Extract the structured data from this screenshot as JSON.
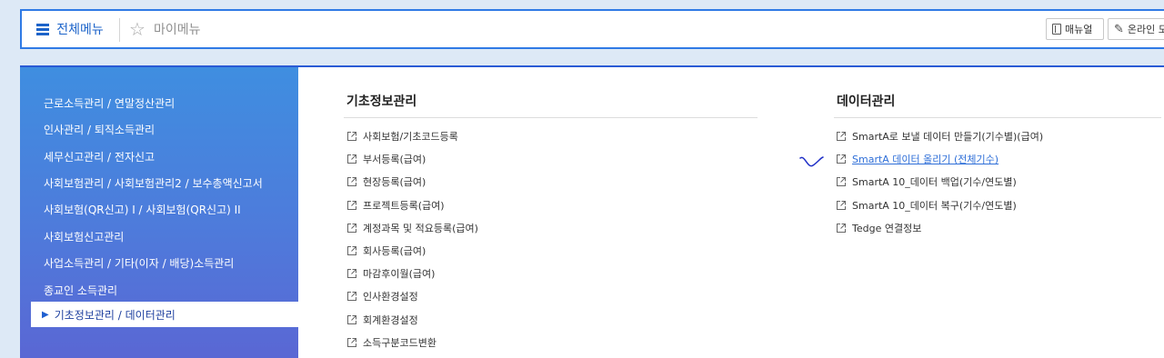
{
  "topbar": {
    "all_menu_label": "전체메뉴",
    "my_menu_label": "마이메뉴",
    "manual_label": "매뉴얼",
    "online_label": "온라인 도움말"
  },
  "sidebar": {
    "items": [
      "근로소득관리 / 연말정산관리",
      "인사관리 / 퇴직소득관리",
      "세무신고관리 / 전자신고",
      "사회보험관리 / 사회보험관리2 / 보수총액신고서",
      "사회보험(QR신고) I  / 사회보험(QR신고) II",
      "사회보험신고관리",
      "사업소득관리 / 기타(이자 / 배당)소득관리",
      "종교인 소득관리",
      "기초정보관리 / 데이터관리"
    ],
    "active_index": 8
  },
  "basic_section": {
    "title": "기초정보관리",
    "links": [
      "사회보험/기초코드등록",
      "부서등록(급여)",
      "현장등록(급여)",
      "프로젝트등록(급여)",
      "계정과목 및 적요등록(급여)",
      "회사등록(급여)",
      "마감후이월(급여)",
      "인사환경설정",
      "회계환경설정",
      "소득구분코드변환"
    ]
  },
  "data_section": {
    "title": "데이터관리",
    "links": [
      "SmartA로 보낼 데이터 만들기(기수별)(급여)",
      "SmartA 데이터 올리기 (전체기수)",
      "SmartA 10_데이터 백업(기수/연도별)",
      "SmartA 10_데이터 복구(기수/연도별)",
      "Tedge 연결정보"
    ],
    "highlighted_index": 1
  },
  "colors": {
    "accent": "#2f7ae5",
    "sidebar_top": "#3f8ee0",
    "sidebar_bottom": "#5a67d4",
    "link_highlight": "#2f6fd8"
  }
}
